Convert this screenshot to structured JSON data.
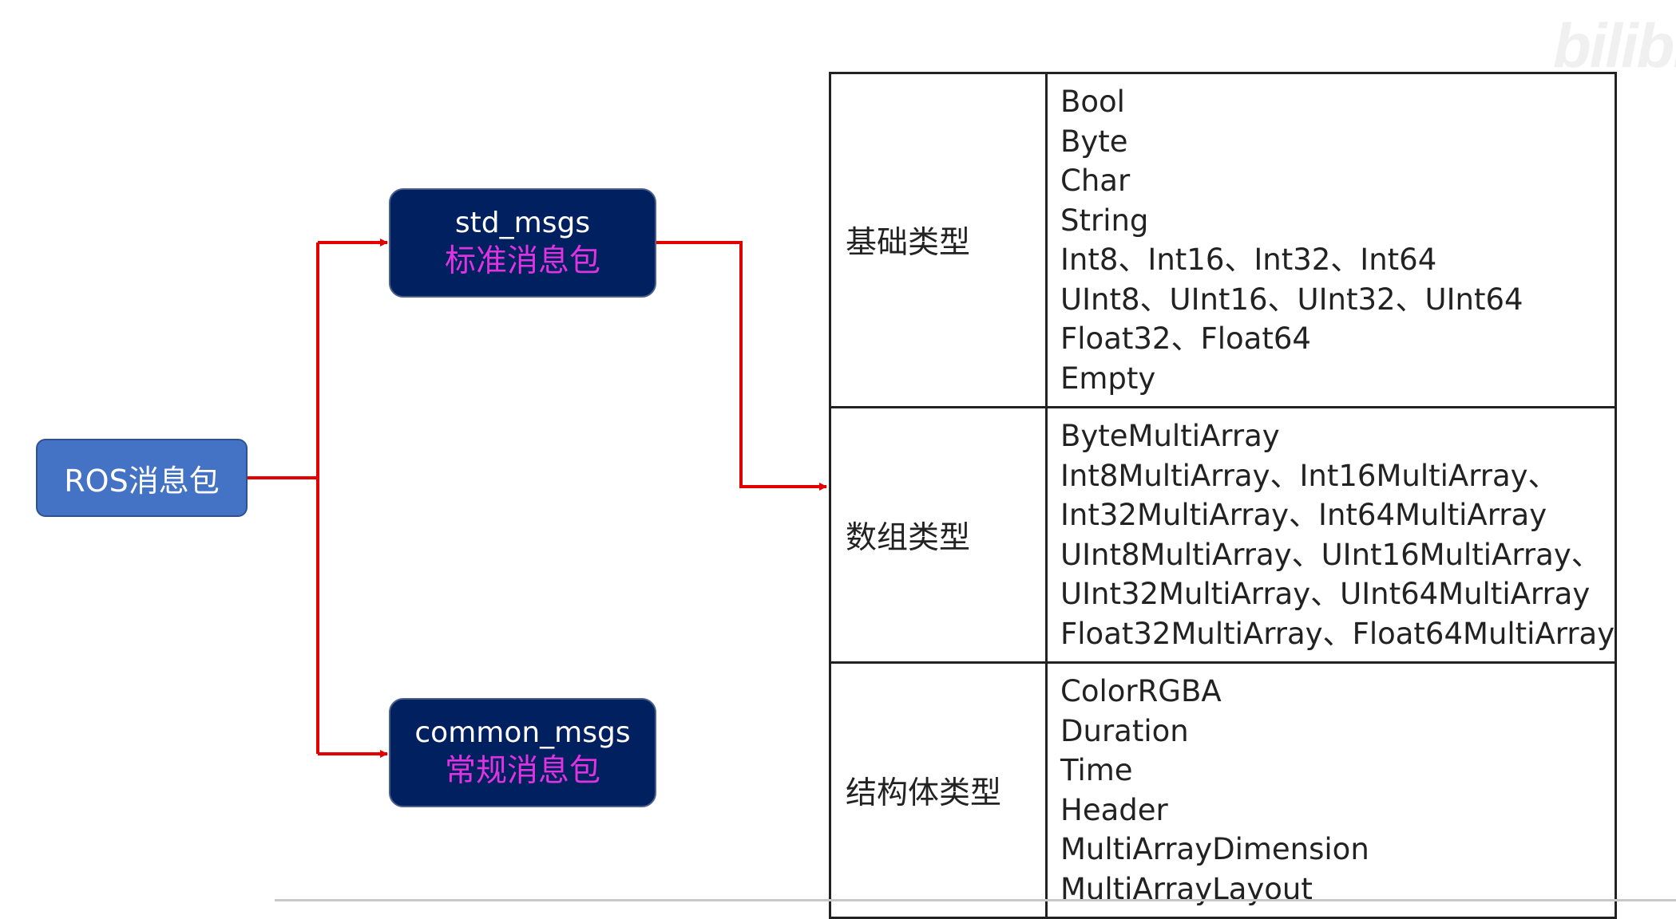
{
  "watermark": "bilibili",
  "root": {
    "label": "ROS消息包"
  },
  "packages": [
    {
      "name": "std_msgs",
      "label": "标准消息包"
    },
    {
      "name": "common_msgs",
      "label": "常规消息包"
    }
  ],
  "colors": {
    "connector": "#e50000",
    "root_fill": "#4472c4",
    "package_fill": "#002060",
    "package_label": "#e033e0"
  },
  "table": [
    {
      "category": "基础类型",
      "items": [
        "Bool",
        "Byte",
        "Char",
        "String",
        "Int8、Int16、Int32、Int64",
        "UInt8、UInt16、UInt32、UInt64",
        "Float32、Float64",
        "Empty"
      ]
    },
    {
      "category": "数组类型",
      "items": [
        "ByteMultiArray",
        "Int8MultiArray、Int16MultiArray、",
        "Int32MultiArray、Int64MultiArray",
        "UInt8MultiArray、UInt16MultiArray、",
        "UInt32MultiArray、UInt64MultiArray",
        "Float32MultiArray、Float64MultiArray"
      ]
    },
    {
      "category": "结构体类型",
      "items": [
        "ColorRGBA",
        "Duration",
        "Time",
        "Header",
        "MultiArrayDimension",
        "MultiArrayLayout"
      ]
    }
  ]
}
